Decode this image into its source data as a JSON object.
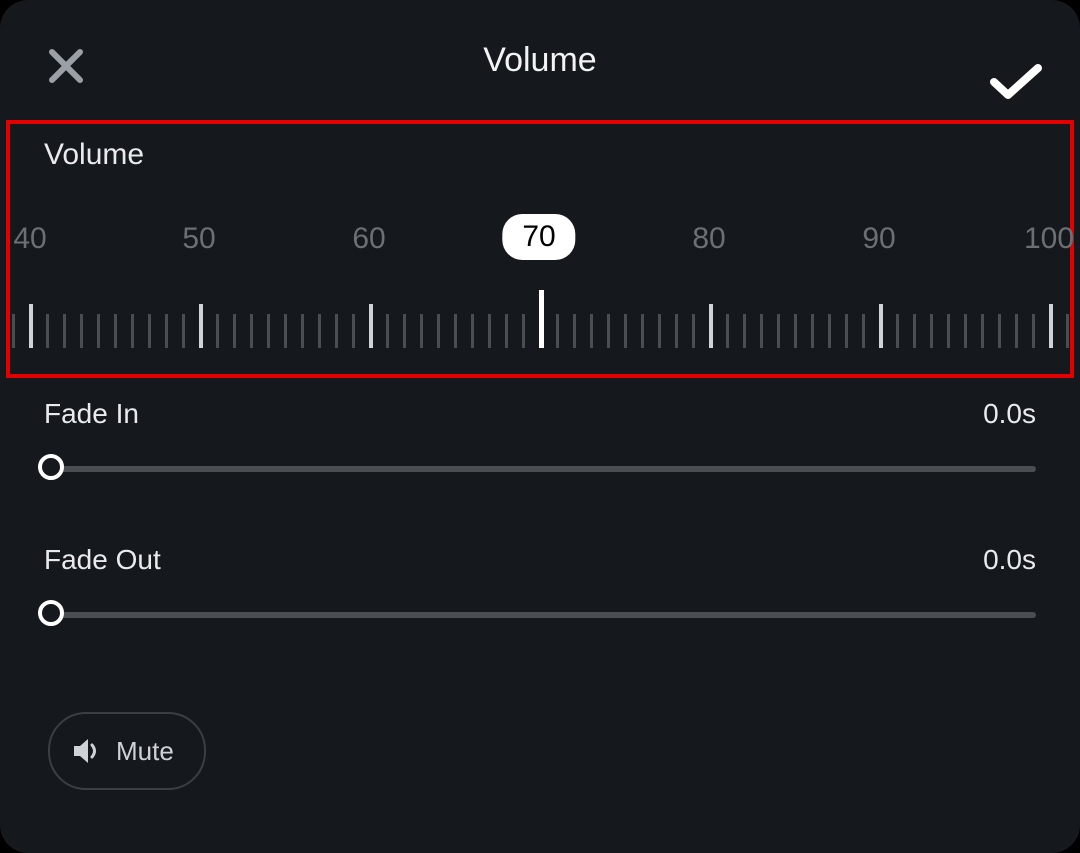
{
  "header": {
    "title": "Volume"
  },
  "volume": {
    "label": "Volume",
    "value": "70",
    "scale_labels": [
      "40",
      "50",
      "60",
      "70",
      "80",
      "90",
      "100"
    ]
  },
  "fade_in": {
    "label": "Fade In",
    "value": "0.0s"
  },
  "fade_out": {
    "label": "Fade Out",
    "value": "0.0s"
  },
  "mute": {
    "label": "Mute"
  }
}
